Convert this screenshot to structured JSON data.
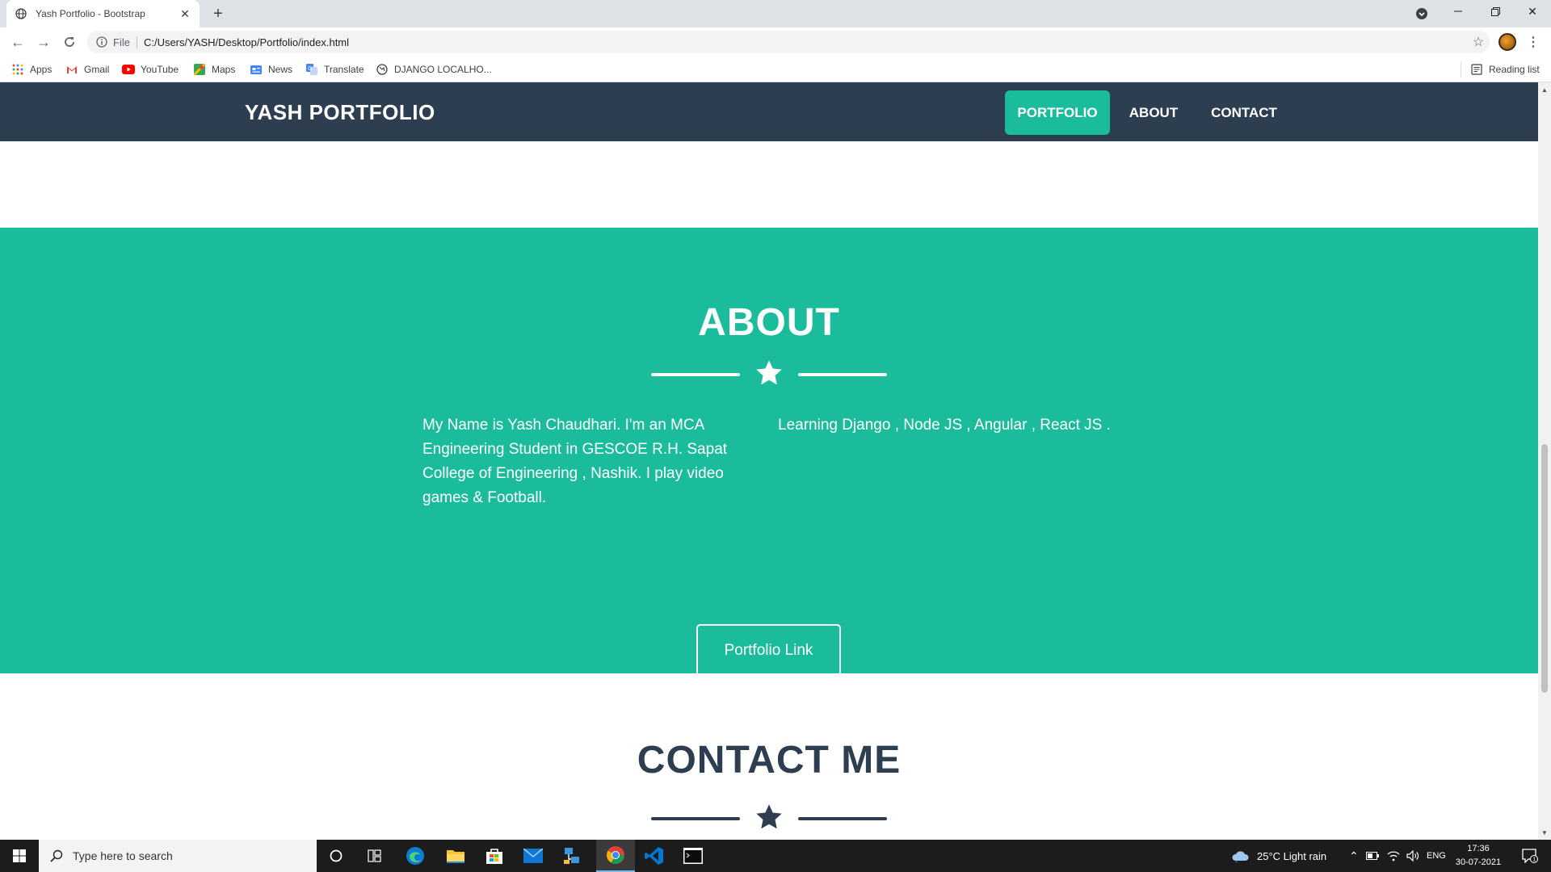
{
  "browser": {
    "tab_title": "Yash Portfolio - Bootstrap",
    "omnibox_scheme": "File",
    "url": "C:/Users/YASH/Desktop/Portfolio/index.html",
    "bookmarks": [
      "Apps",
      "Gmail",
      "YouTube",
      "Maps",
      "News",
      "Translate",
      "DJANGO LOCALHO..."
    ],
    "reading_list": "Reading list"
  },
  "site": {
    "brand": "YASH PORTFOLIO",
    "nav": [
      "PORTFOLIO",
      "ABOUT",
      "CONTACT"
    ],
    "active_nav": "PORTFOLIO",
    "about": {
      "title": "ABOUT",
      "text_left": "My Name is Yash Chaudhari. I'm an MCA Engineering Student in GESCOE R.H. Sapat College of Engineering , Nashik. I play video games & Football.",
      "text_right": "Learning Django , Node JS , Angular , React JS .",
      "button": "Portfolio Link"
    },
    "contact": {
      "title": "CONTACT ME"
    },
    "colors": {
      "nav_bg": "#2c3e50",
      "accent": "#1abc9c",
      "heading_dark": "#2c3e50"
    }
  },
  "taskbar": {
    "search_placeholder": "Type here to search",
    "weather": "25°C  Light rain",
    "language": "ENG",
    "time": "17:36",
    "date": "30-07-2021",
    "notification_count": "1"
  }
}
